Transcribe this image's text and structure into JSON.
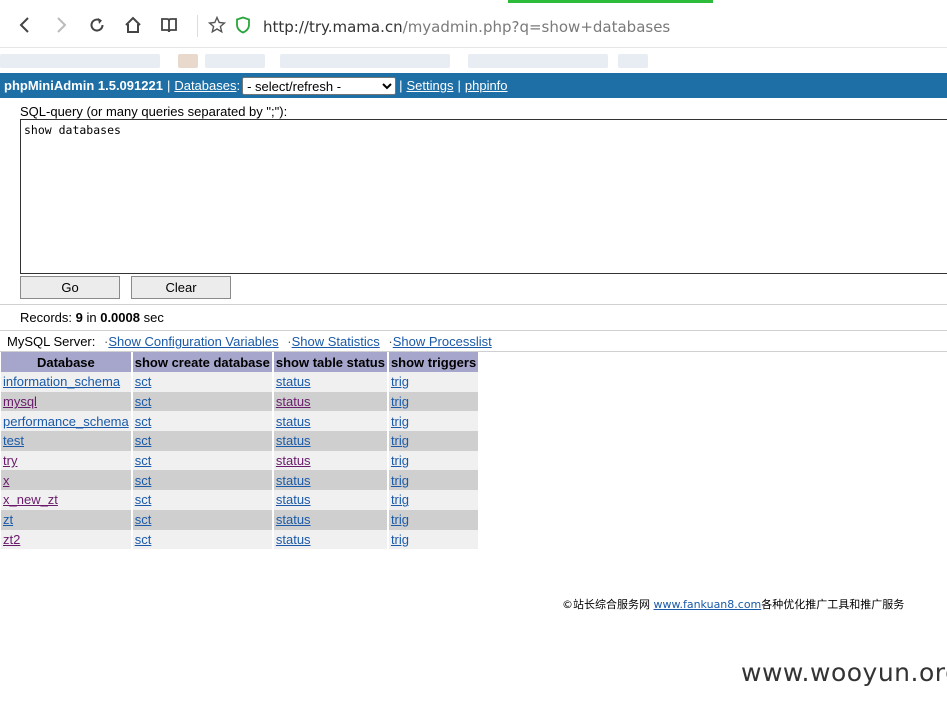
{
  "browser": {
    "url_host": "http://try.mama.cn",
    "url_path": "/myadmin.php?q=show+databases",
    "loadbar_color": "#2dbb3a"
  },
  "header": {
    "app_title": "phpMiniAdmin 1.5.091221",
    "databases_link": "Databases",
    "colon": ":",
    "select_value": "- select/refresh -",
    "settings_link": "Settings",
    "phpinfo_link": "phpinfo",
    "bg_color": "#1d6fa6"
  },
  "query": {
    "label": "SQL-query (or many queries separated by \";\"):",
    "value": "show databases",
    "go_label": "Go",
    "clear_label": "Clear"
  },
  "records": {
    "prefix": "Records: ",
    "count": "9",
    "mid": " in ",
    "time": "0.0008",
    "suffix": " sec"
  },
  "server": {
    "label": "MySQL Server:",
    "links": [
      "Show Configuration Variables",
      "Show Statistics",
      "Show Processlist"
    ]
  },
  "table": {
    "headers": [
      "Database",
      "show create database",
      "show table status",
      "show triggers"
    ],
    "rows": [
      {
        "db": "information_schema",
        "sct": "sct",
        "status": "status",
        "trig": "trig",
        "db_visited": false,
        "status_visited": false
      },
      {
        "db": "mysql",
        "sct": "sct",
        "status": "status",
        "trig": "trig",
        "db_visited": true,
        "status_visited": true
      },
      {
        "db": "performance_schema",
        "sct": "sct",
        "status": "status",
        "trig": "trig",
        "db_visited": false,
        "status_visited": false
      },
      {
        "db": "test",
        "sct": "sct",
        "status": "status",
        "trig": "trig",
        "db_visited": false,
        "status_visited": false
      },
      {
        "db": "try",
        "sct": "sct",
        "status": "status",
        "trig": "trig",
        "db_visited": true,
        "status_visited": true
      },
      {
        "db": "x",
        "sct": "sct",
        "status": "status",
        "trig": "trig",
        "db_visited": true,
        "status_visited": false
      },
      {
        "db": "x_new_zt",
        "sct": "sct",
        "status": "status",
        "trig": "trig",
        "db_visited": true,
        "status_visited": false
      },
      {
        "db": "zt",
        "sct": "sct",
        "status": "status",
        "trig": "trig",
        "db_visited": false,
        "status_visited": false
      },
      {
        "db": "zt2",
        "sct": "sct",
        "status": "status",
        "trig": "trig",
        "db_visited": true,
        "status_visited": false
      }
    ]
  },
  "footer": {
    "prefix": "©站长综合服务网 ",
    "link": "www.fankuan8.com",
    "suffix": "各种优化推广工具和推广服务"
  },
  "watermark": "www.wooyun.org"
}
